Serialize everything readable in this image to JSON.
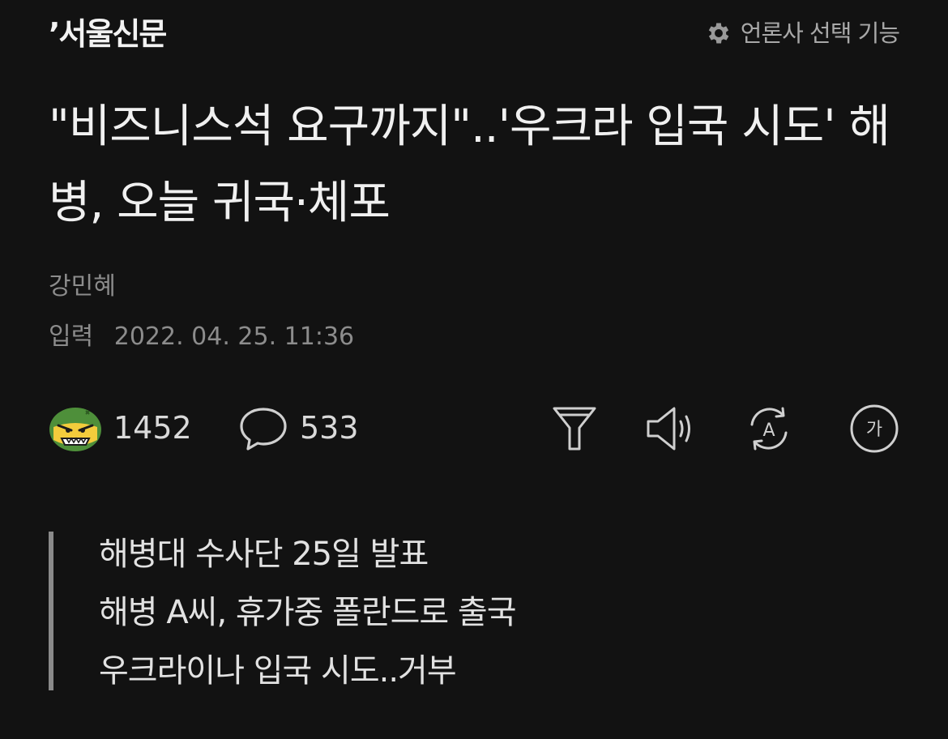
{
  "header": {
    "logo_text": "’서울신문",
    "publisher_select_label": "언론사 선택 기능",
    "publisher_select_icon": "gear-icon"
  },
  "article": {
    "title": "\"비즈니스석 요구까지\"..'우크라 입국 시도' 해병, 오늘 귀국·체포",
    "author": "강민혜",
    "date_label": "입력",
    "date_value": "2022. 04. 25. 11:36"
  },
  "actions": {
    "reaction_icon": "angry-face-icon",
    "reaction_count": "1452",
    "comment_icon": "speech-bubble-icon",
    "comment_count": "533",
    "tools": [
      "funnel-icon",
      "speaker-icon",
      "translate-icon",
      "font-size-icon"
    ],
    "translate_glyph": "A",
    "font_size_glyph": "가"
  },
  "summary": {
    "lines": [
      "해병대 수사단 25일 발표",
      "해병 A씨, 휴가중 폴란드로 출국",
      "우크라이나 입국 시도..거부"
    ]
  },
  "colors": {
    "background": "#121212",
    "text": "#f0f0f0",
    "muted": "#8c8c8c",
    "reaction_green": "#4e8f3a",
    "reaction_yellow": "#f3cc3c"
  }
}
